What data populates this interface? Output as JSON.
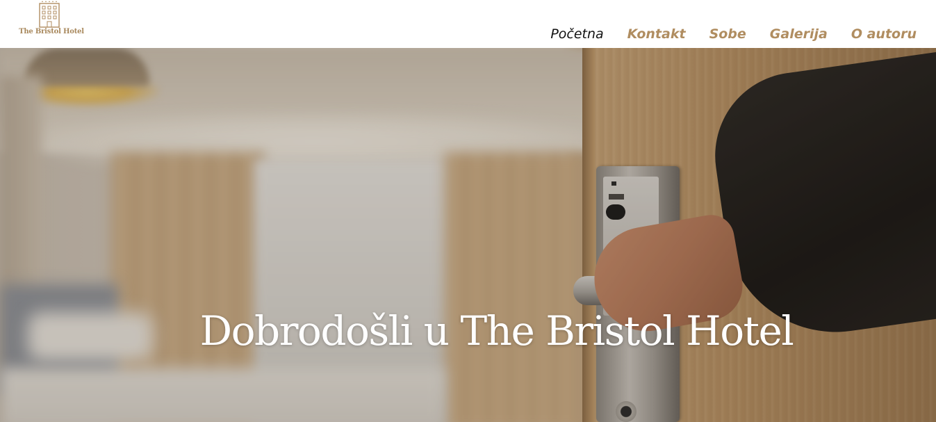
{
  "brand": {
    "name": "The Bristol Hotel",
    "logo_icon": "hotel-building-icon",
    "accent_color": "#b08d60"
  },
  "nav": {
    "items": [
      {
        "label": "Početna",
        "active": true
      },
      {
        "label": "Kontakt",
        "active": false
      },
      {
        "label": "Sobe",
        "active": false
      },
      {
        "label": "Galerija",
        "active": false
      },
      {
        "label": "O autoru",
        "active": false
      }
    ]
  },
  "hero": {
    "title": "Dobrodošli u The Bristol Hotel",
    "image_subject": "hand-opening-hotel-room-door"
  }
}
